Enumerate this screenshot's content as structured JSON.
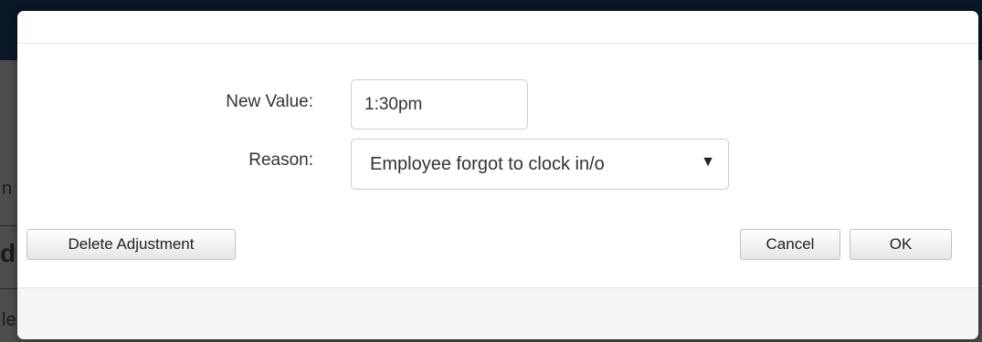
{
  "background": {
    "fragment_a": "n",
    "fragment_b": "d",
    "fragment_c": "le"
  },
  "dialog": {
    "fields": {
      "new_value_label": "New Value:",
      "new_value": "1:30pm",
      "reason_label": "Reason:",
      "reason_selected": "Employee forgot to clock in/o"
    },
    "buttons": {
      "delete_label": "Delete Adjustment",
      "cancel_label": "Cancel",
      "ok_label": "OK"
    }
  },
  "icons": {
    "dropdown_arrow": "▼"
  },
  "colors": {
    "overlay": "#4d4d4d",
    "topbar": "#0a1726",
    "dialog_bg": "#ffffff",
    "footer_bg": "#f5f5f5",
    "border": "#cccccc",
    "text": "#333333"
  }
}
